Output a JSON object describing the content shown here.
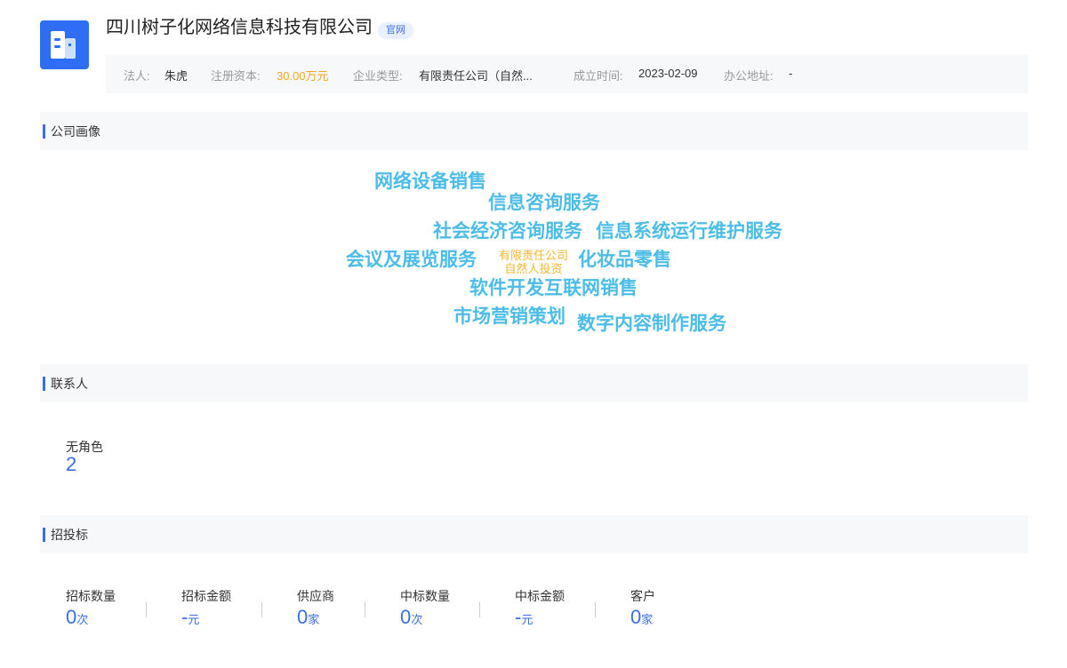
{
  "company": {
    "name": "四川树子化网络信息科技有限公司",
    "badge": "官网"
  },
  "info": [
    {
      "label": "法人:",
      "value": "朱虎"
    },
    {
      "label": "注册资本:",
      "value": "30.00万元"
    },
    {
      "label": "企业类型:",
      "value": "有限责任公司（自然..."
    },
    {
      "label": "成立时间:",
      "value": "2023-02-09"
    },
    {
      "label": "办公地址:",
      "value": "-"
    }
  ],
  "sections": {
    "portrait": "公司画像",
    "contacts": "联系人",
    "bidding": "招投标"
  },
  "cloud": {
    "words": [
      "网络设备销售",
      "信息咨询服务",
      "社会经济咨询服务",
      "信息系统运行维护服务",
      "会议及展览服务",
      "化妆品零售",
      "软件开发互联网销售",
      "市场营销策划",
      "数字内容制作服务"
    ],
    "small": [
      "有限责任公司",
      "自然人投资"
    ]
  },
  "contacts": {
    "label": "无角色",
    "count": "2"
  },
  "bidding": [
    {
      "label": "招标数量",
      "value": "0",
      "unit": "次"
    },
    {
      "label": "招标金额",
      "value": "-",
      "unit": "元"
    },
    {
      "label": "供应商",
      "value": "0",
      "unit": "家"
    },
    {
      "label": "中标数量",
      "value": "0",
      "unit": "次"
    },
    {
      "label": "中标金额",
      "value": "-",
      "unit": "元"
    },
    {
      "label": "客户",
      "value": "0",
      "unit": "家"
    }
  ],
  "colors": {
    "accent": "#3a6ee8",
    "logo": "#2f6df5",
    "cloud": "#4dbde8",
    "highlight": "#f5a623"
  },
  "icons": {
    "logo": "building-icon"
  }
}
